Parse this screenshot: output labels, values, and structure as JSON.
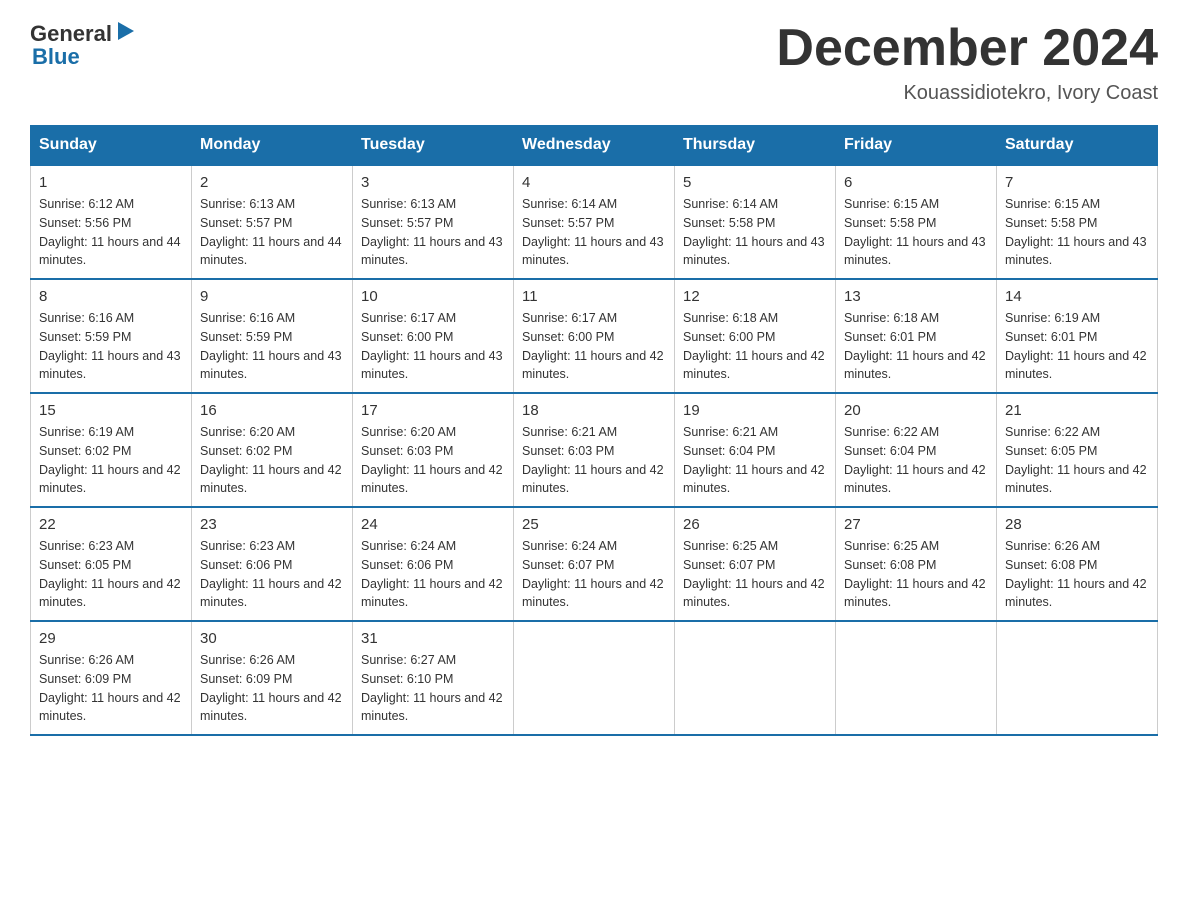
{
  "logo": {
    "general": "General",
    "blue": "Blue"
  },
  "title": "December 2024",
  "location": "Kouassidiotekro, Ivory Coast",
  "days": [
    "Sunday",
    "Monday",
    "Tuesday",
    "Wednesday",
    "Thursday",
    "Friday",
    "Saturday"
  ],
  "weeks": [
    [
      {
        "num": "1",
        "sunrise": "6:12 AM",
        "sunset": "5:56 PM",
        "daylight": "11 hours and 44 minutes."
      },
      {
        "num": "2",
        "sunrise": "6:13 AM",
        "sunset": "5:57 PM",
        "daylight": "11 hours and 44 minutes."
      },
      {
        "num": "3",
        "sunrise": "6:13 AM",
        "sunset": "5:57 PM",
        "daylight": "11 hours and 43 minutes."
      },
      {
        "num": "4",
        "sunrise": "6:14 AM",
        "sunset": "5:57 PM",
        "daylight": "11 hours and 43 minutes."
      },
      {
        "num": "5",
        "sunrise": "6:14 AM",
        "sunset": "5:58 PM",
        "daylight": "11 hours and 43 minutes."
      },
      {
        "num": "6",
        "sunrise": "6:15 AM",
        "sunset": "5:58 PM",
        "daylight": "11 hours and 43 minutes."
      },
      {
        "num": "7",
        "sunrise": "6:15 AM",
        "sunset": "5:58 PM",
        "daylight": "11 hours and 43 minutes."
      }
    ],
    [
      {
        "num": "8",
        "sunrise": "6:16 AM",
        "sunset": "5:59 PM",
        "daylight": "11 hours and 43 minutes."
      },
      {
        "num": "9",
        "sunrise": "6:16 AM",
        "sunset": "5:59 PM",
        "daylight": "11 hours and 43 minutes."
      },
      {
        "num": "10",
        "sunrise": "6:17 AM",
        "sunset": "6:00 PM",
        "daylight": "11 hours and 43 minutes."
      },
      {
        "num": "11",
        "sunrise": "6:17 AM",
        "sunset": "6:00 PM",
        "daylight": "11 hours and 42 minutes."
      },
      {
        "num": "12",
        "sunrise": "6:18 AM",
        "sunset": "6:00 PM",
        "daylight": "11 hours and 42 minutes."
      },
      {
        "num": "13",
        "sunrise": "6:18 AM",
        "sunset": "6:01 PM",
        "daylight": "11 hours and 42 minutes."
      },
      {
        "num": "14",
        "sunrise": "6:19 AM",
        "sunset": "6:01 PM",
        "daylight": "11 hours and 42 minutes."
      }
    ],
    [
      {
        "num": "15",
        "sunrise": "6:19 AM",
        "sunset": "6:02 PM",
        "daylight": "11 hours and 42 minutes."
      },
      {
        "num": "16",
        "sunrise": "6:20 AM",
        "sunset": "6:02 PM",
        "daylight": "11 hours and 42 minutes."
      },
      {
        "num": "17",
        "sunrise": "6:20 AM",
        "sunset": "6:03 PM",
        "daylight": "11 hours and 42 minutes."
      },
      {
        "num": "18",
        "sunrise": "6:21 AM",
        "sunset": "6:03 PM",
        "daylight": "11 hours and 42 minutes."
      },
      {
        "num": "19",
        "sunrise": "6:21 AM",
        "sunset": "6:04 PM",
        "daylight": "11 hours and 42 minutes."
      },
      {
        "num": "20",
        "sunrise": "6:22 AM",
        "sunset": "6:04 PM",
        "daylight": "11 hours and 42 minutes."
      },
      {
        "num": "21",
        "sunrise": "6:22 AM",
        "sunset": "6:05 PM",
        "daylight": "11 hours and 42 minutes."
      }
    ],
    [
      {
        "num": "22",
        "sunrise": "6:23 AM",
        "sunset": "6:05 PM",
        "daylight": "11 hours and 42 minutes."
      },
      {
        "num": "23",
        "sunrise": "6:23 AM",
        "sunset": "6:06 PM",
        "daylight": "11 hours and 42 minutes."
      },
      {
        "num": "24",
        "sunrise": "6:24 AM",
        "sunset": "6:06 PM",
        "daylight": "11 hours and 42 minutes."
      },
      {
        "num": "25",
        "sunrise": "6:24 AM",
        "sunset": "6:07 PM",
        "daylight": "11 hours and 42 minutes."
      },
      {
        "num": "26",
        "sunrise": "6:25 AM",
        "sunset": "6:07 PM",
        "daylight": "11 hours and 42 minutes."
      },
      {
        "num": "27",
        "sunrise": "6:25 AM",
        "sunset": "6:08 PM",
        "daylight": "11 hours and 42 minutes."
      },
      {
        "num": "28",
        "sunrise": "6:26 AM",
        "sunset": "6:08 PM",
        "daylight": "11 hours and 42 minutes."
      }
    ],
    [
      {
        "num": "29",
        "sunrise": "6:26 AM",
        "sunset": "6:09 PM",
        "daylight": "11 hours and 42 minutes."
      },
      {
        "num": "30",
        "sunrise": "6:26 AM",
        "sunset": "6:09 PM",
        "daylight": "11 hours and 42 minutes."
      },
      {
        "num": "31",
        "sunrise": "6:27 AM",
        "sunset": "6:10 PM",
        "daylight": "11 hours and 42 minutes."
      },
      null,
      null,
      null,
      null
    ]
  ],
  "colors": {
    "header_bg": "#1a6ea8",
    "header_text": "#ffffff",
    "border": "#aaaaaa",
    "row_border": "#1a6ea8"
  }
}
